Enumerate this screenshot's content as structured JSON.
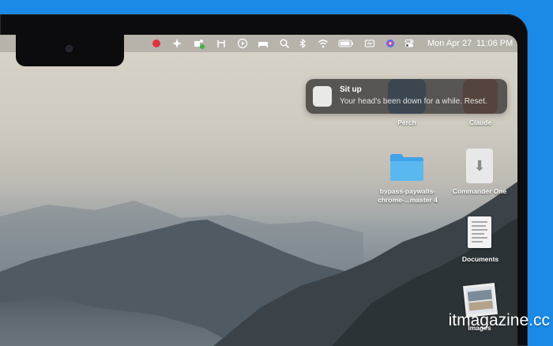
{
  "menubar": {
    "date": "Mon Apr 27",
    "time": "11:06 PM",
    "icons": [
      "record-icon",
      "sparkle-icon",
      "teams-icon",
      "airdrop-icon",
      "play-icon",
      "bed-icon",
      "search-icon",
      "bluetooth-icon",
      "wifi-icon",
      "battery-icon",
      "display-icon",
      "siri-icon",
      "control-center-icon"
    ]
  },
  "notification": {
    "title": "Sit up",
    "body": "Your head's been down for a while. Reset."
  },
  "desktop": {
    "items": [
      {
        "label": "Perch"
      },
      {
        "label": "Claude"
      },
      {
        "label_line1": "bypass-paywalls-",
        "label_line2": "chrome-...master 4"
      },
      {
        "label": "Commander One"
      },
      {
        "label": "Documents"
      },
      {
        "label": "Images"
      }
    ]
  },
  "watermark": "itmagazine.cc",
  "colors": {
    "background": "#1a8ae6",
    "folder": "#5ab8f0",
    "record": "#e0343a"
  }
}
